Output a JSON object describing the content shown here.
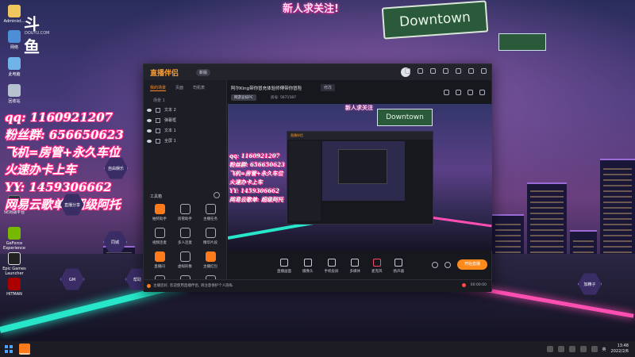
{
  "desktop": {
    "brand_logo": "斗鱼",
    "brand_site": "DOUYU.COM",
    "icons": [
      {
        "label": "Administ...",
        "icon": "user-folder-icon"
      },
      {
        "label": "网络",
        "icon": "network-icon"
      },
      {
        "label": "此电脑",
        "icon": "computer-icon"
      },
      {
        "label": "回收站",
        "icon": "recycle-bin-icon"
      },
      {
        "label": "5E对战平台",
        "icon": "5e-platform-icon"
      },
      {
        "label": "GeForce Experience",
        "icon": "geforce-icon"
      },
      {
        "label": "Epic Games Launcher",
        "icon": "epic-games-icon"
      },
      {
        "label": "HITMAN",
        "icon": "hitman-icon"
      }
    ],
    "new_follow_banner": "新人求关注!",
    "road_sign": "Downtown",
    "overlay_lines": [
      "qq: 1160921207",
      "粉丝群: 656650623",
      "飞机=房管+永久车位",
      "火速办卡上车",
      "YY: 1459306662",
      "网易云歌单: 超级阿托"
    ],
    "hex_buttons": [
      {
        "label": "自由娱乐",
        "name": "hex-free-fun"
      },
      {
        "label": "直播分享",
        "name": "hex-live-share"
      },
      {
        "label": "同城",
        "name": "hex-same-city"
      },
      {
        "label": "GM",
        "name": "hex-gm"
      },
      {
        "label": "帮助",
        "name": "hex-help"
      },
      {
        "label": "加精子",
        "name": "hex-right"
      }
    ]
  },
  "app": {
    "name": "直播伴侣",
    "version_badge": "新版",
    "left_tabs": [
      "我的场景",
      "页面",
      "司机表"
    ],
    "scene_header": "场景 1",
    "layers": [
      {
        "label": "文本 2"
      },
      {
        "label": "弹幕框"
      },
      {
        "label": "文本 1"
      },
      {
        "label": "全屏 1"
      }
    ],
    "tools_title": "工具箱",
    "tools": [
      {
        "label": "抽奖助手",
        "hot": true
      },
      {
        "label": "房管助手",
        "hot": false
      },
      {
        "label": "主播任务",
        "hot": false
      },
      {
        "label": "视频连麦",
        "hot": false
      },
      {
        "label": "多人连麦",
        "hot": false
      },
      {
        "label": "精华片段",
        "hot": false
      },
      {
        "label": "直播间",
        "hot": true
      },
      {
        "label": "虚拟形象",
        "hot": false
      },
      {
        "label": "主播红包",
        "hot": true
      },
      {
        "label": "...",
        "hot": false
      },
      {
        "label": "...",
        "hot": false
      },
      {
        "label": "...",
        "hot": false
      }
    ],
    "room_title": "阿尔King带你冒充体验师傅带你冒险",
    "title_edit": "修改",
    "category": "网游竞技PC",
    "meta": "房号: 5671587",
    "preview_sign": "Downtown",
    "preview_follow": "新人求关注",
    "preview_overlay": [
      "qq: 1160921207",
      "粉丝群: 656650623",
      "飞机=房管+永久车位",
      "火速办卡上车",
      "YY: 1459306662",
      "网易云歌单: 超级阿托"
    ],
    "bottom_actions": [
      {
        "label": "直播画面",
        "name": "live-screen-button"
      },
      {
        "label": "摄像头",
        "name": "camera-button"
      },
      {
        "label": "手机投屏",
        "name": "phone-cast-button"
      },
      {
        "label": "多媒体",
        "name": "multimedia-button"
      },
      {
        "label": "麦克风",
        "name": "mic-button"
      },
      {
        "label": "扬声器",
        "name": "speaker-button"
      }
    ],
    "start_button": "开始直播",
    "status_text": "主播您好, 欢迎使用直播伴侣, 请注意保护个人隐私",
    "status_time": "00:00:00"
  },
  "taskbar": {
    "time": "13:48",
    "date": "2022/2/6",
    "lang": "英",
    "accent_color": "#ff8a1c"
  }
}
